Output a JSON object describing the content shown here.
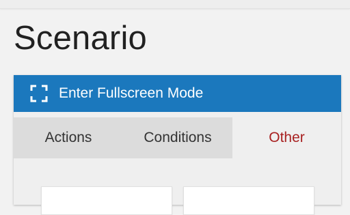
{
  "page": {
    "title": "Scenario"
  },
  "fullscreen": {
    "label": "Enter Fullscreen Mode",
    "icon": "fullscreen-icon"
  },
  "tabs": [
    {
      "label": "Actions",
      "active": false
    },
    {
      "label": "Conditions",
      "active": false
    },
    {
      "label": "Other",
      "active": true
    }
  ],
  "colors": {
    "accent": "#1b78bd",
    "active_tab_text": "#a82121",
    "tab_bar": "#dcdcdc",
    "background": "#f2f2f2"
  }
}
